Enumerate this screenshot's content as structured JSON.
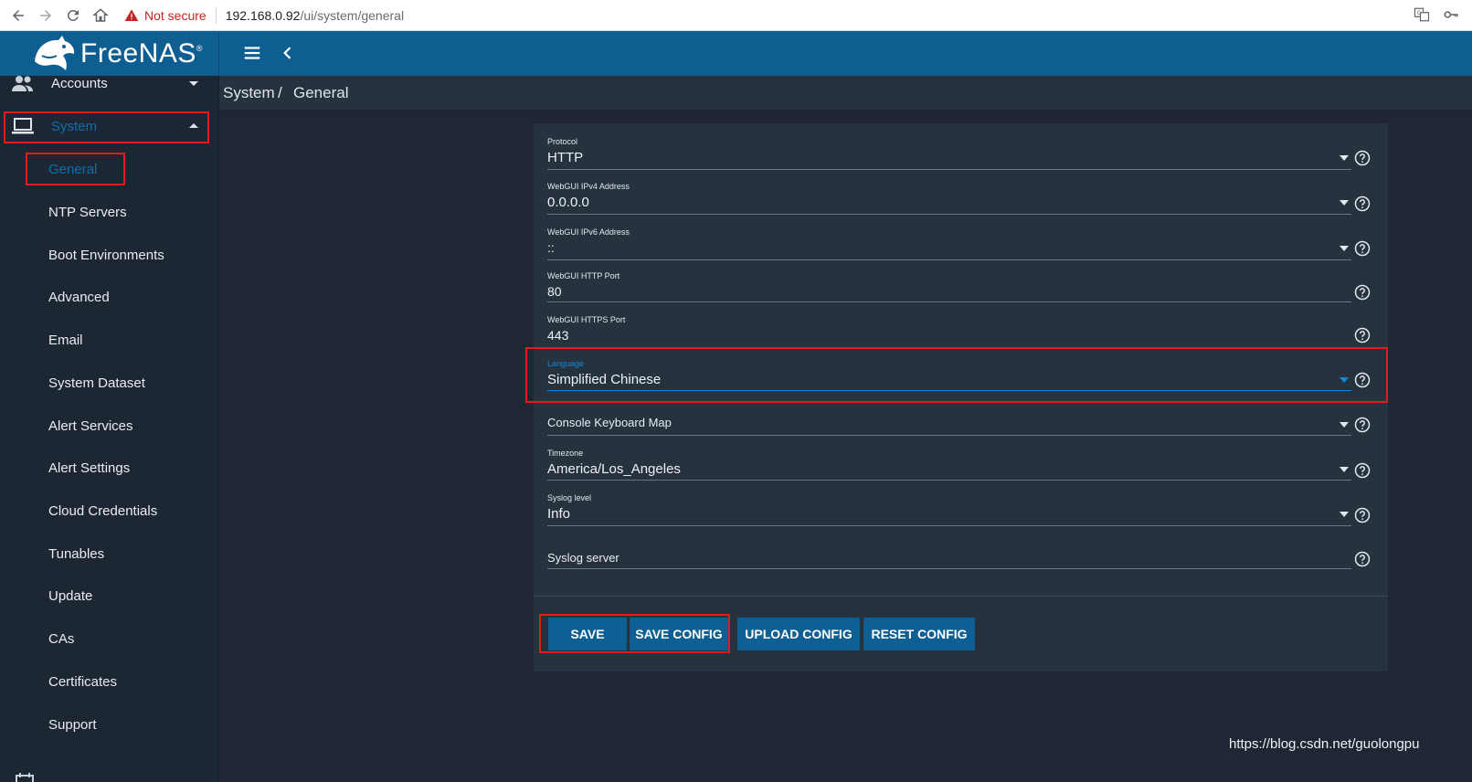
{
  "browser": {
    "security": "Not secure",
    "url_host": "192.168.0.92",
    "url_path": "/ui/system/general"
  },
  "header": {
    "brand": "FreeNAS",
    "trademark": "®"
  },
  "sidebar": {
    "accounts": "Accounts",
    "system": "System",
    "sub_items": [
      "General",
      "NTP Servers",
      "Boot Environments",
      "Advanced",
      "Email",
      "System Dataset",
      "Alert Services",
      "Alert Settings",
      "Cloud Credentials",
      "Tunables",
      "Update",
      "CAs",
      "Certificates",
      "Support"
    ]
  },
  "breadcrumb": {
    "section": "System",
    "separator": "/",
    "page": "General"
  },
  "form": {
    "protocol": {
      "label": "Protocol",
      "value": "HTTP"
    },
    "ipv4": {
      "label": "WebGUI IPv4 Address",
      "value": "0.0.0.0"
    },
    "ipv6": {
      "label": "WebGUI IPv6 Address",
      "value": "::"
    },
    "http_port": {
      "label": "WebGUI HTTP Port",
      "value": "80"
    },
    "https_port": {
      "label": "WebGUI HTTPS Port",
      "value": "443"
    },
    "language": {
      "label": "Language",
      "value": "Simplified Chinese"
    },
    "keyboard": {
      "placeholder": "Console Keyboard Map"
    },
    "timezone": {
      "label": "Timezone",
      "value": "America/Los_Angeles"
    },
    "syslog_level": {
      "label": "Syslog level",
      "value": "Info"
    },
    "syslog_server": {
      "placeholder": "Syslog server"
    }
  },
  "buttons": {
    "save": "SAVE",
    "save_config": "SAVE CONFIG",
    "upload_config": "UPLOAD CONFIG",
    "reset_config": "RESET CONFIG"
  },
  "watermark": "https://blog.csdn.net/guolongpu",
  "colors": {
    "header": "#0e5e92",
    "sidebar": "#1d2734",
    "card": "#27323f",
    "accent": "#1387d6",
    "button": "#0e5f93",
    "highlight": "#e21b1b"
  }
}
